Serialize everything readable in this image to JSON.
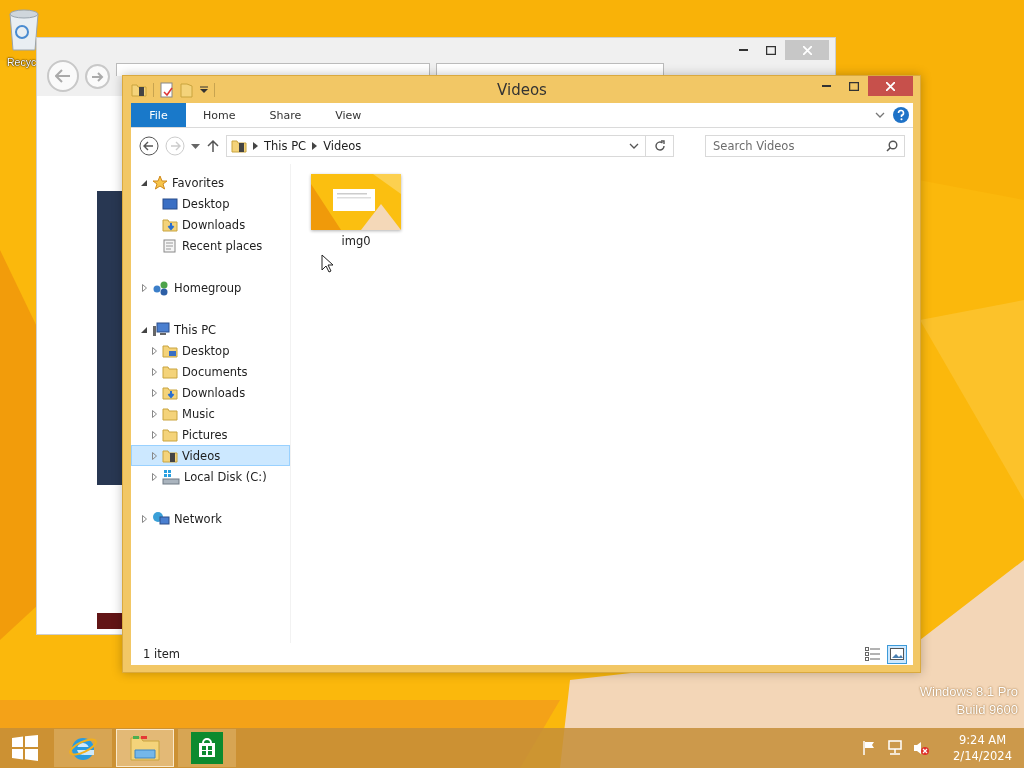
{
  "desktop": {
    "icons": [
      {
        "label": "Recyc"
      }
    ],
    "edition": [
      "Windows 8.1 Pro",
      "Build 9600"
    ]
  },
  "explorer": {
    "title": "Videos",
    "ribbon_tabs": [
      {
        "label": "File",
        "kind": "file",
        "selected": false
      },
      {
        "label": "Home",
        "kind": "tab",
        "selected": false
      },
      {
        "label": "Share",
        "kind": "tab",
        "selected": false
      },
      {
        "label": "View",
        "kind": "tab",
        "selected": false
      }
    ],
    "address": {
      "crumbs": [
        "This PC",
        "Videos"
      ]
    },
    "search": {
      "placeholder": "Search Videos"
    },
    "nav": [
      {
        "label": "Favorites",
        "kind": "star",
        "expanded": true,
        "selected": false,
        "children": [
          {
            "label": "Desktop",
            "kind": "desktop",
            "selected": false
          },
          {
            "label": "Downloads",
            "kind": "downloads",
            "selected": false
          },
          {
            "label": "Recent places",
            "kind": "recent",
            "selected": false
          }
        ]
      },
      {
        "label": "Homegroup",
        "kind": "homegroup",
        "expanded": false,
        "selected": false
      },
      {
        "label": "This PC",
        "kind": "pc",
        "expanded": true,
        "selected": false,
        "children": [
          {
            "label": "Desktop",
            "kind": "folder-desktop",
            "expanded": false,
            "selected": false
          },
          {
            "label": "Documents",
            "kind": "folder",
            "expanded": false,
            "selected": false
          },
          {
            "label": "Downloads",
            "kind": "downloads",
            "expanded": false,
            "selected": false
          },
          {
            "label": "Music",
            "kind": "folder",
            "expanded": false,
            "selected": false
          },
          {
            "label": "Pictures",
            "kind": "folder",
            "expanded": false,
            "selected": false
          },
          {
            "label": "Videos",
            "kind": "videos",
            "expanded": false,
            "selected": true
          },
          {
            "label": "Local Disk (C:)",
            "kind": "disk",
            "expanded": false,
            "selected": false
          }
        ]
      },
      {
        "label": "Network",
        "kind": "network",
        "expanded": false,
        "selected": false
      }
    ],
    "items": [
      {
        "name": "img0",
        "kind": "picture"
      }
    ],
    "status": "1 item",
    "view_buttons": [
      {
        "kind": "details",
        "selected": false
      },
      {
        "kind": "large-icons",
        "selected": true
      }
    ]
  },
  "taskbar": {
    "apps": [
      {
        "kind": "ie",
        "selected": false
      },
      {
        "kind": "explorer",
        "selected": true
      },
      {
        "kind": "store",
        "selected": false
      }
    ],
    "tray": [
      {
        "kind": "flag"
      },
      {
        "kind": "network"
      },
      {
        "kind": "speaker-muted"
      }
    ],
    "clock": {
      "time": "9:24 AM",
      "date": "2/14/2024"
    }
  }
}
